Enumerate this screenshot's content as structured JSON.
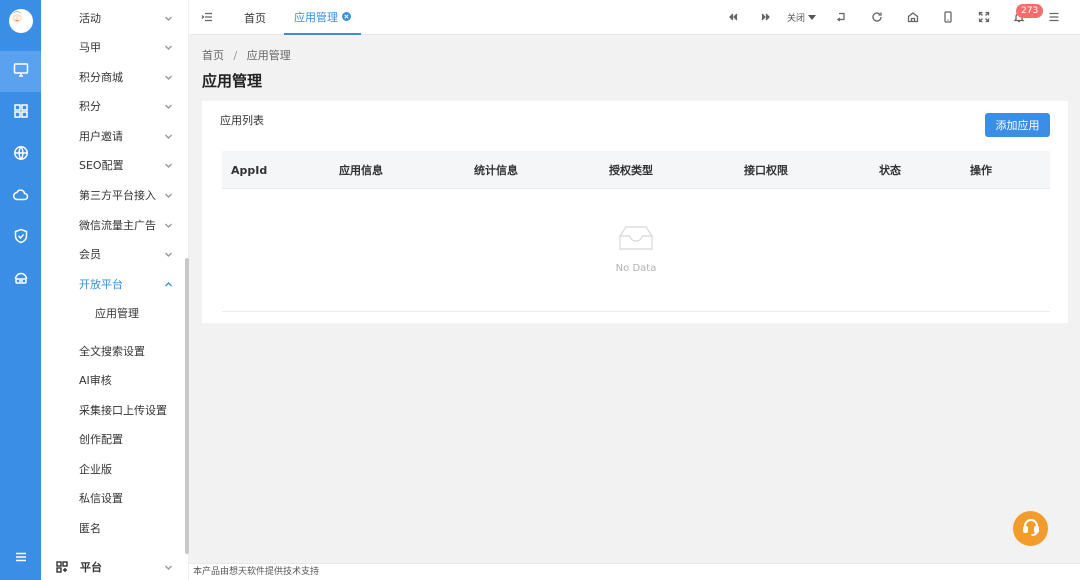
{
  "sidebar": {
    "items": [
      {
        "label": "活动",
        "chevron": "down"
      },
      {
        "label": "马甲",
        "chevron": "down"
      },
      {
        "label": "积分商城",
        "chevron": "down"
      },
      {
        "label": "积分",
        "chevron": "down"
      },
      {
        "label": "用户邀请",
        "chevron": "down"
      },
      {
        "label": "SEO配置",
        "chevron": "down"
      },
      {
        "label": "第三方平台接入",
        "chevron": "down"
      },
      {
        "label": "微信流量主广告",
        "chevron": "down"
      },
      {
        "label": "会员",
        "chevron": "down"
      },
      {
        "label": "开放平台",
        "chevron": "up"
      },
      {
        "label": "应用管理",
        "chevron": ""
      },
      {
        "label": "全文搜索设置",
        "chevron": ""
      },
      {
        "label": "AI审核",
        "chevron": ""
      },
      {
        "label": "采集接口上传设置",
        "chevron": ""
      },
      {
        "label": "创作配置",
        "chevron": ""
      },
      {
        "label": "企业版",
        "chevron": ""
      },
      {
        "label": "私信设置",
        "chevron": ""
      },
      {
        "label": "匿名",
        "chevron": ""
      }
    ],
    "bottom_label": "平台",
    "rail_icons": [
      "monitor-icon",
      "grid-icon",
      "globe-icon",
      "cloud-icon",
      "shield-icon",
      "router-icon"
    ]
  },
  "topbar": {
    "tabs": [
      {
        "label": "首页"
      },
      {
        "label": "应用管理"
      }
    ],
    "close_menu_label": "关闭",
    "notification_count": "273"
  },
  "breadcrumb": {
    "home": "首页",
    "separator": "/",
    "current": "应用管理"
  },
  "page": {
    "title": "应用管理"
  },
  "card": {
    "title": "应用列表",
    "add_button": "添加应用",
    "columns": [
      "AppId",
      "应用信息",
      "统计信息",
      "授权类型",
      "接口权限",
      "状态",
      "操作"
    ],
    "empty_text": "No Data"
  },
  "footer": {
    "text": "本产品由想天软件提供技术支持"
  },
  "colors": {
    "primary": "#3a8ee6",
    "badge": "#f56c6c",
    "support": "#f39c2c"
  }
}
